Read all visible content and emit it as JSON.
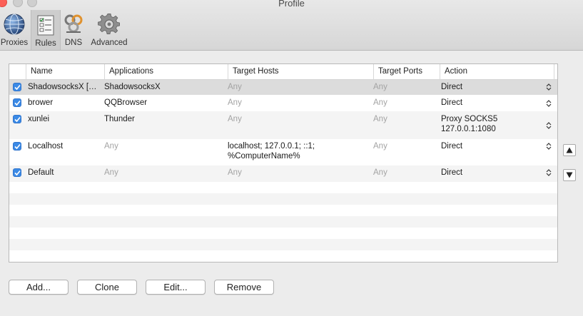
{
  "window": {
    "title": "Profile"
  },
  "toolbar": {
    "items": [
      {
        "label": "Proxies",
        "icon": "globe-icon"
      },
      {
        "label": "Rules",
        "icon": "rules-list-icon",
        "selected": true
      },
      {
        "label": "DNS",
        "icon": "dns-icon"
      },
      {
        "label": "Advanced",
        "icon": "gear-icon"
      }
    ]
  },
  "table": {
    "columns": [
      "Name",
      "Applications",
      "Target Hosts",
      "Target Ports",
      "Action"
    ],
    "rows": [
      {
        "checked": true,
        "name": "ShadowsocksX […",
        "applications": "ShadowsocksX",
        "hosts": "Any",
        "ports": "Any",
        "action": "Direct"
      },
      {
        "checked": true,
        "name": "brower",
        "applications": "QQBrowser",
        "hosts": "Any",
        "ports": "Any",
        "action": "Direct"
      },
      {
        "checked": true,
        "name": "xunlei",
        "applications": "Thunder",
        "hosts": "Any",
        "ports": "Any",
        "action": "Proxy SOCKS5",
        "action2": "127.0.0.1:1080"
      },
      {
        "checked": true,
        "name": "Localhost",
        "applications": "Any",
        "hosts": "localhost; 127.0.0.1; ::1;",
        "hosts2": "%ComputerName%",
        "ports": "Any",
        "action": "Direct"
      },
      {
        "checked": true,
        "name": "Default",
        "applications": "Any",
        "hosts": "Any",
        "ports": "Any",
        "action": "Direct"
      }
    ]
  },
  "buttons": {
    "add": "Add...",
    "clone": "Clone",
    "edit": "Edit...",
    "remove": "Remove"
  },
  "colors": {
    "accent": "#3b8ae6",
    "close": "#fc5f57"
  }
}
